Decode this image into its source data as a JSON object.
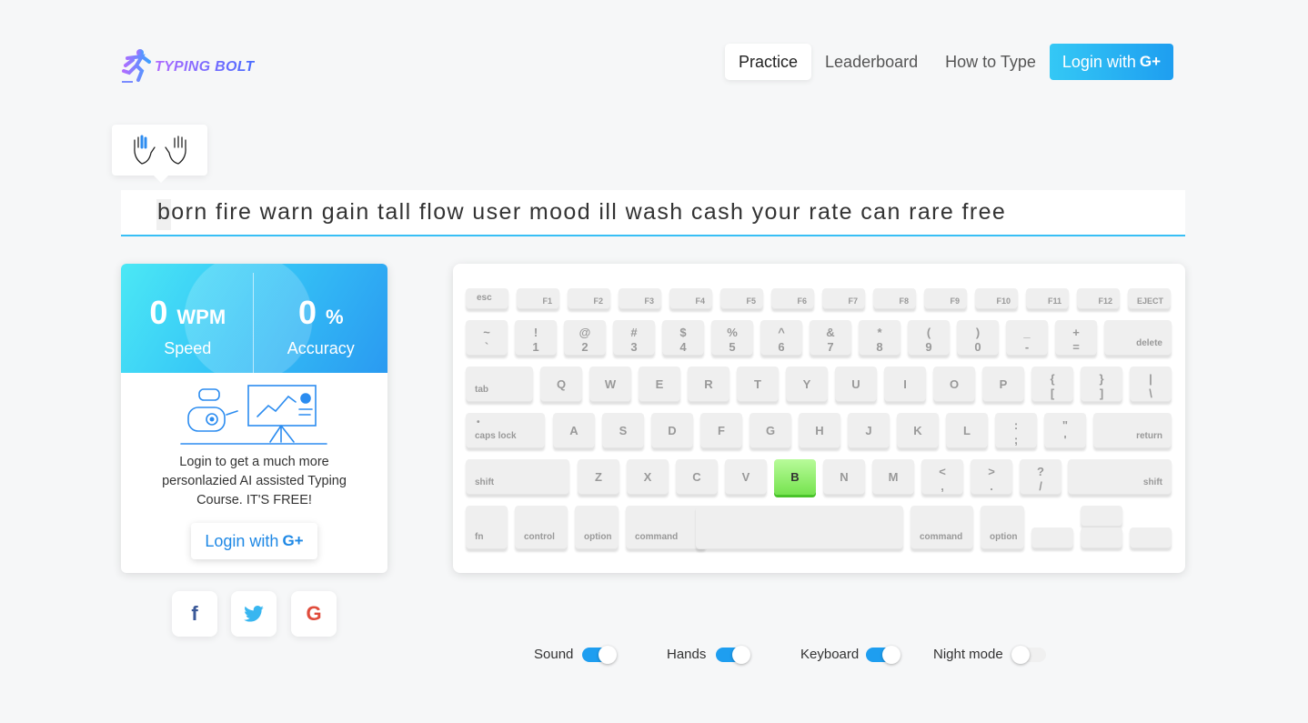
{
  "header": {
    "logo_text": "TYPING BOLT",
    "nav": [
      {
        "label": "Practice",
        "active": true
      },
      {
        "label": "Leaderboard",
        "active": false
      },
      {
        "label": "How to Type",
        "active": false
      }
    ],
    "login_label": "Login with",
    "login_icon": "G+"
  },
  "typing": {
    "text": "born fire warn gain tall flow user mood ill wash cash your rate can rare free"
  },
  "stats": {
    "speed_value": "0",
    "speed_unit": "WPM",
    "speed_label": "Speed",
    "accuracy_value": "0",
    "accuracy_unit": "%",
    "accuracy_label": "Accuracy",
    "promo_text": "Login to get a much more personlazied AI assisted Typing Course. IT'S FREE!",
    "login_label": "Login with",
    "login_icon": "G+"
  },
  "social": [
    {
      "name": "facebook",
      "glyph": "f",
      "color": "#3b5998"
    },
    {
      "name": "twitter",
      "glyph": "🐦",
      "color": "#38b6f0"
    },
    {
      "name": "google",
      "glyph": "G",
      "color": "#e04c3c"
    }
  ],
  "keyboard": {
    "active_key": "B",
    "row0": [
      "esc",
      "F1",
      "F2",
      "F3",
      "F4",
      "F5",
      "F6",
      "F7",
      "F8",
      "F9",
      "F10",
      "F11",
      "F12",
      "EJECT"
    ],
    "row1": [
      [
        "~",
        "`"
      ],
      [
        "!",
        "1"
      ],
      [
        "@",
        "2"
      ],
      [
        "#",
        "3"
      ],
      [
        "$",
        "4"
      ],
      [
        "%",
        "5"
      ],
      [
        "^",
        "6"
      ],
      [
        "&",
        "7"
      ],
      [
        "*",
        "8"
      ],
      [
        "(",
        "9"
      ],
      [
        ")",
        "0"
      ],
      [
        "_",
        "-"
      ],
      [
        "+",
        "="
      ]
    ],
    "row1_end": "delete",
    "row2_start": "tab",
    "row2": [
      "Q",
      "W",
      "E",
      "R",
      "T",
      "Y",
      "U",
      "I",
      "O",
      "P"
    ],
    "row2_sym": [
      [
        "{",
        "["
      ],
      [
        "}",
        "]"
      ],
      [
        "|",
        "\\"
      ]
    ],
    "row3_start": "caps lock",
    "row3": [
      "A",
      "S",
      "D",
      "F",
      "G",
      "H",
      "J",
      "K",
      "L"
    ],
    "row3_sym": [
      [
        ":",
        ";"
      ],
      [
        "\"",
        "'"
      ]
    ],
    "row3_end": "return",
    "row4_start": "shift",
    "row4": [
      "Z",
      "X",
      "C",
      "V",
      "B",
      "N",
      "M"
    ],
    "row4_sym": [
      [
        "<",
        ","
      ],
      [
        ">",
        "."
      ],
      [
        "?",
        "/"
      ]
    ],
    "row4_end": "shift",
    "row5": [
      "fn",
      "control",
      "option",
      "command",
      "command",
      "option"
    ]
  },
  "toggles": [
    {
      "label": "Sound",
      "on": true
    },
    {
      "label": "Hands",
      "on": true
    },
    {
      "label": "Keyboard",
      "on": true
    },
    {
      "label": "Night mode",
      "on": false
    }
  ],
  "colors": {
    "accent": "#1e9ef0",
    "active_key": "#76e34f"
  }
}
